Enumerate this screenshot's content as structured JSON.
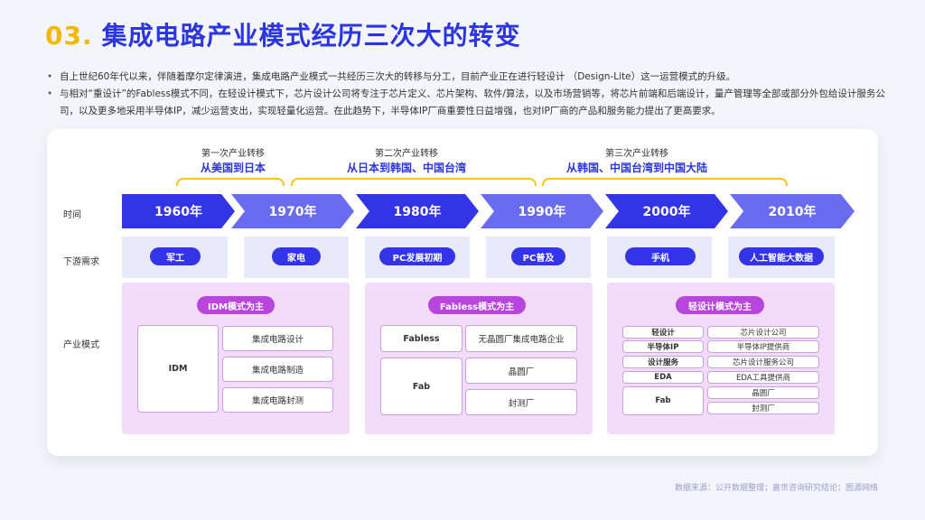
{
  "header": {
    "number": "03.",
    "title": "集成电路产业模式经历三次大的转变"
  },
  "bullets": [
    "自上世纪60年代以来，伴随着摩尔定律演进，集成电路产业模式一共经历三次大的转移与分工，目前产业正在进行轻设计 （Design-Lite）这一运营模式的升级。",
    "与相对“重设计”的Fabless模式不同，在轻设计模式下，芯片设计公司将专注于芯片定义、芯片架构、软件/算法，以及市场营销等，将芯片前端和后端设计，量产管理等全部或部分外包给设计服务公司，以及更多地采用半导体IP，减少运营支出，实现轻量化运营。在此趋势下，半导体IP厂商重要性日益增强，也对IP厂商的产品和服务能力提出了更高要求。"
  ],
  "shifts": [
    {
      "label": "第一次产业转移",
      "route": "从美国到日本"
    },
    {
      "label": "第二次产业转移",
      "route": "从日本到韩国、中国台湾"
    },
    {
      "label": "第三次产业转移",
      "route": "从韩国、中国台湾到中国大陆"
    }
  ],
  "row_labels": {
    "time": "时间",
    "demand": "下游需求",
    "mode": "产业模式"
  },
  "years": [
    "1960年",
    "1970年",
    "1980年",
    "1990年",
    "2000年",
    "2010年"
  ],
  "demands": [
    "军工",
    "家电",
    "PC发展初期",
    "PC普及",
    "手机",
    "人工智能大数据"
  ],
  "modes": {
    "idm": {
      "title": "IDM模式为主",
      "left": "IDM",
      "items": [
        "集成电路设计",
        "集成电路制造",
        "集成电路封测"
      ]
    },
    "fabless": {
      "title": "Fabless模式为主",
      "fabless_label": "Fabless",
      "fabless_item": "无晶圆厂集成电路企业",
      "fab_label": "Fab",
      "fab_items": [
        "晶圆厂",
        "封测厂"
      ]
    },
    "lite": {
      "title": "轻设计模式为主",
      "rows": [
        {
          "left": "轻设计",
          "right": "芯片设计公司"
        },
        {
          "left": "半导体IP",
          "right": "半导体IP提供商"
        },
        {
          "left": "设计服务",
          "right": "芯片设计服务公司"
        },
        {
          "left": "EDA",
          "right": "EDA工具提供商"
        }
      ],
      "fab_label": "Fab",
      "fab_items": [
        "晶圆厂",
        "封测厂"
      ]
    }
  },
  "source": "数据来源：公开数据整理；嘉世咨询研究结论；图源网络",
  "colors": {
    "primary": "#2b35e0",
    "accent": "#f5b800",
    "chevron_dark": "#3234e6",
    "chevron_light": "#6a6cf0",
    "mode_pill": "#b845dc",
    "mode_bg": "#f3dcfa"
  }
}
